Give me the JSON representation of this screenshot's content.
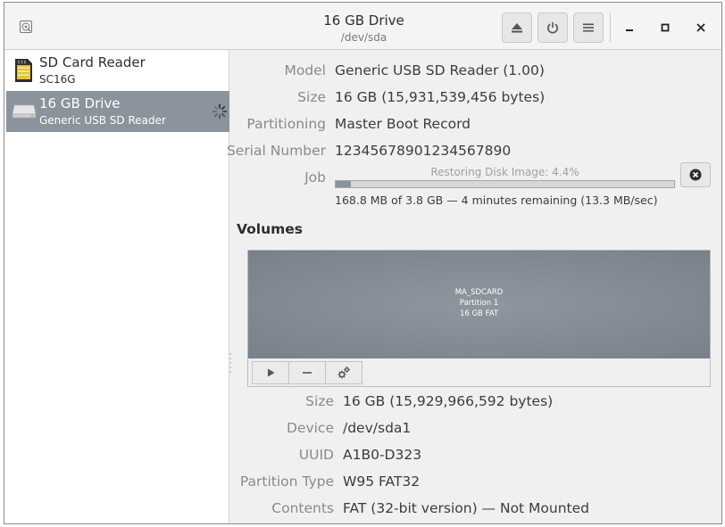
{
  "header": {
    "title": "16 GB Drive",
    "subtitle": "/dev/sda",
    "buttons": [
      "eject-icon",
      "power-icon",
      "menu-icon"
    ],
    "window_controls": [
      "minimize-icon",
      "maximize-icon",
      "close-icon"
    ]
  },
  "sidebar": {
    "items": [
      {
        "name": "SD Card Reader",
        "sub": "SC16G",
        "icon": "sd-card-icon",
        "selected": false
      },
      {
        "name": "16 GB Drive",
        "sub": "Generic USB  SD Reader",
        "icon": "drive-icon",
        "selected": true,
        "busy": true
      }
    ]
  },
  "drive": {
    "model_label": "Model",
    "model": "Generic USB  SD Reader (1.00)",
    "size_label": "Size",
    "size": "16 GB (15,931,539,456 bytes)",
    "partitioning_label": "Partitioning",
    "partitioning": "Master Boot Record",
    "serial_label": "Serial Number",
    "serial": "12345678901234567890",
    "job_label": "Job",
    "job_text": "Restoring Disk Image: 4.4%",
    "job_progress": 0.044,
    "job_detail": "168.8 MB of 3.8 GB — 4 minutes remaining (13.3 MB/sec)"
  },
  "volumes": {
    "heading": "Volumes",
    "partition": {
      "line1": "MA_SDCARD",
      "line2": "Partition 1",
      "line3": "16 GB FAT"
    },
    "toolbar": [
      "play-icon",
      "minus-icon",
      "gears-icon"
    ],
    "size_label": "Size",
    "size": "16 GB (15,929,966,592 bytes)",
    "device_label": "Device",
    "device": "/dev/sda1",
    "uuid_label": "UUID",
    "uuid": "A1B0-D323",
    "ptype_label": "Partition Type",
    "ptype": "W95 FAT32",
    "contents_label": "Contents",
    "contents": "FAT (32-bit version) — Not Mounted"
  },
  "colors": {
    "selection": "#8b949d",
    "partition": "#838b94"
  }
}
